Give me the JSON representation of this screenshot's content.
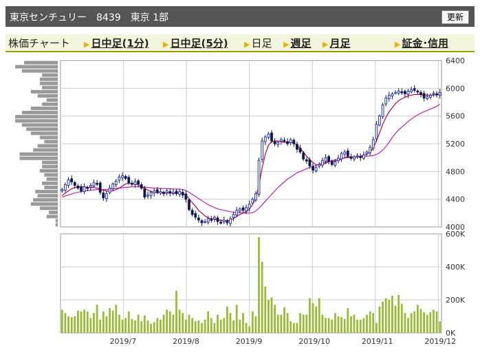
{
  "header": {
    "title": "東京センチュリー　8439　東京 1部",
    "refresh_label": "更新"
  },
  "tabs": [
    {
      "label": "株価チャート",
      "link": false,
      "arrow": false
    },
    {
      "label": "日中足(1分)",
      "link": true,
      "arrow": true
    },
    {
      "label": "日中足(5分)",
      "link": true,
      "arrow": true
    },
    {
      "label": "日足",
      "link": false,
      "arrow": true
    },
    {
      "label": "週足",
      "link": true,
      "arrow": true
    },
    {
      "label": "月足",
      "link": true,
      "arrow": true
    },
    {
      "label": "証金･信用",
      "link": true,
      "arrow": true
    }
  ],
  "colors": {
    "up_candle": "#2233cc",
    "down_candle": "#0a1a4a",
    "ma_short": "#cc0033",
    "ma_long": "#bb22bb",
    "volume_bar": "#99bb33",
    "volume_profile": "#999999",
    "grid": "#cccccc"
  },
  "chart_data": [
    {
      "type": "candlestick",
      "title": "",
      "x_labels": [
        "2019/7",
        "2019/8",
        "2019/9",
        "2019/10",
        "2019/11",
        "2019/12"
      ],
      "y_ticks": [
        "4000",
        "4400",
        "4800",
        "5200",
        "5600",
        "6000",
        "6400"
      ],
      "ylim": [
        4000,
        6400
      ],
      "grid": true,
      "close": [
        4540,
        4610,
        4680,
        4650,
        4600,
        4560,
        4520,
        4580,
        4560,
        4600,
        4640,
        4620,
        4500,
        4420,
        4480,
        4560,
        4620,
        4660,
        4720,
        4740,
        4700,
        4640,
        4620,
        4650,
        4620,
        4560,
        4430,
        4460,
        4500,
        4520,
        4500,
        4510,
        4480,
        4520,
        4490,
        4500,
        4480,
        4510,
        4460,
        4400,
        4250,
        4180,
        4140,
        4100,
        4060,
        4080,
        4120,
        4100,
        4140,
        4080,
        4060,
        4100,
        4060,
        4120,
        4180,
        4240,
        4260,
        4240,
        4280,
        4330,
        4400,
        4480,
        4960,
        5240,
        5300,
        5340,
        5240,
        5200,
        5220,
        5260,
        5240,
        5200,
        5260,
        5200,
        5120,
        5080,
        4980,
        4950,
        4880,
        4820,
        4860,
        4900,
        4960,
        5000,
        4950,
        4900,
        4940,
        4990,
        5060,
        5080,
        5020,
        4990,
        5010,
        5030,
        5000,
        5040,
        5080,
        5150,
        5260,
        5480,
        5600,
        5760,
        5860,
        5900,
        5920,
        5940,
        5960,
        5940,
        5920,
        5960,
        5980,
        5970,
        5950,
        5910,
        5860,
        5880,
        5900,
        5930,
        5910,
        5940
      ],
      "ma_short": [
        4450,
        4490,
        4520,
        4550,
        4570,
        4580,
        4580,
        4580,
        4570,
        4570,
        4570,
        4560,
        4545,
        4530,
        4520,
        4515,
        4520,
        4540,
        4560,
        4590,
        4620,
        4630,
        4630,
        4620,
        4610,
        4580,
        4560,
        4530,
        4510,
        4500,
        4495,
        4495,
        4490,
        4490,
        4490,
        4490,
        4490,
        4490,
        4480,
        4460,
        4410,
        4350,
        4300,
        4240,
        4200,
        4160,
        4130,
        4120,
        4110,
        4100,
        4095,
        4090,
        4090,
        4100,
        4120,
        4150,
        4180,
        4200,
        4220,
        4260,
        4320,
        4420,
        4600,
        4850,
        5050,
        5180,
        5230,
        5240,
        5240,
        5230,
        5220,
        5220,
        5220,
        5210,
        5180,
        5130,
        5080,
        5020,
        4970,
        4930,
        4900,
        4890,
        4900,
        4920,
        4940,
        4950,
        4950,
        4960,
        4980,
        5000,
        5010,
        5010,
        5010,
        5010,
        5020,
        5030,
        5050,
        5080,
        5140,
        5240,
        5360,
        5480,
        5580,
        5660,
        5720,
        5780,
        5820,
        5850,
        5870,
        5890,
        5900,
        5910,
        5910,
        5910,
        5900,
        5900,
        5900,
        5900,
        5910,
        5910
      ],
      "ma_long": [
        4430,
        4445,
        4460,
        4475,
        4490,
        4500,
        4510,
        4520,
        4525,
        4530,
        4535,
        4540,
        4540,
        4540,
        4540,
        4545,
        4550,
        4555,
        4560,
        4565,
        4570,
        4575,
        4578,
        4580,
        4580,
        4578,
        4575,
        4570,
        4565,
        4560,
        4558,
        4556,
        4554,
        4552,
        4550,
        4548,
        4546,
        4545,
        4540,
        4525,
        4500,
        4470,
        4440,
        4410,
        4380,
        4350,
        4320,
        4300,
        4280,
        4260,
        4250,
        4240,
        4230,
        4220,
        4215,
        4210,
        4205,
        4200,
        4200,
        4200,
        4205,
        4230,
        4270,
        4320,
        4370,
        4420,
        4470,
        4520,
        4570,
        4610,
        4650,
        4690,
        4720,
        4750,
        4780,
        4800,
        4820,
        4840,
        4860,
        4875,
        4890,
        4905,
        4920,
        4935,
        4945,
        4955,
        4965,
        4975,
        4985,
        4995,
        5000,
        5005,
        5008,
        5010,
        5012,
        5015,
        5020,
        5025,
        5030,
        5045,
        5070,
        5110,
        5160,
        5220,
        5290,
        5350,
        5400,
        5440,
        5480,
        5520,
        5555,
        5590,
        5615,
        5640,
        5660,
        5680,
        5700,
        5720,
        5740,
        5770
      ],
      "volume_profile": [
        2,
        2,
        10,
        8,
        16,
        24,
        22,
        18,
        20,
        12,
        14,
        10,
        12,
        16,
        14,
        14,
        34,
        34,
        22,
        18,
        12,
        16,
        24,
        28,
        32,
        38,
        38,
        32,
        24,
        14,
        10,
        18,
        24,
        14,
        16,
        16,
        14,
        32,
        38,
        30
      ]
    },
    {
      "type": "bar",
      "title": "",
      "y_ticks": [
        "0K",
        "200K",
        "400K",
        "600K"
      ],
      "ylim": [
        0,
        600
      ],
      "values": [
        140,
        120,
        100,
        95,
        100,
        135,
        130,
        140,
        130,
        90,
        120,
        170,
        80,
        130,
        100,
        150,
        135,
        170,
        110,
        80,
        90,
        130,
        85,
        75,
        110,
        70,
        105,
        75,
        55,
        65,
        90,
        80,
        110,
        140,
        130,
        110,
        255,
        140,
        120,
        80,
        110,
        90,
        70,
        75,
        60,
        80,
        130,
        90,
        60,
        110,
        80,
        90,
        160,
        120,
        75,
        170,
        80,
        120,
        60,
        40,
        130,
        100,
        580,
        430,
        280,
        200,
        215,
        170,
        110,
        110,
        155,
        120,
        70,
        60,
        60,
        120,
        110,
        110,
        210,
        180,
        160,
        210,
        110,
        90,
        90,
        80,
        120,
        100,
        95,
        85,
        150,
        100,
        110,
        80,
        80,
        90,
        110,
        130,
        120,
        60,
        160,
        190,
        210,
        200,
        225,
        165,
        230,
        175,
        120,
        90,
        120,
        130,
        170,
        145,
        125,
        110,
        125,
        140,
        130,
        70
      ]
    }
  ]
}
